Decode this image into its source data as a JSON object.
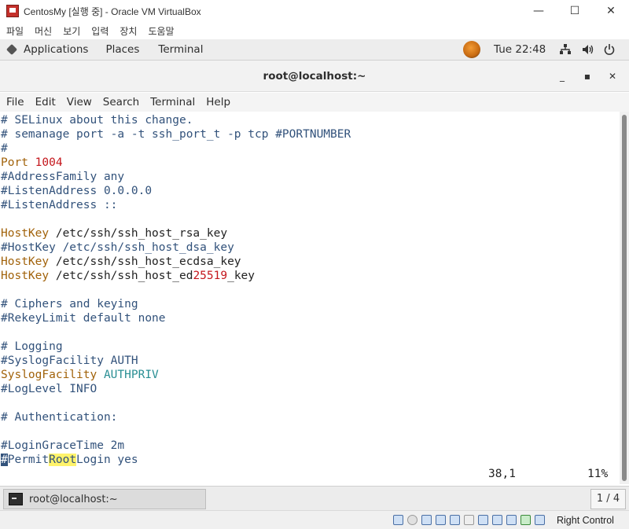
{
  "vbox": {
    "title": "CentosMy [실행 중] - Oracle VM VirtualBox",
    "minimize": "—",
    "maximize": "☐",
    "close": "✕",
    "menu": [
      "파일",
      "머신",
      "보기",
      "입력",
      "장치",
      "도움말"
    ],
    "host_key": "Right Control"
  },
  "gnome": {
    "applications": "Applications",
    "places": "Places",
    "terminal": "Terminal",
    "clock": "Tue 22:48",
    "network_icon": "network-icon",
    "volume_icon": "volume-icon",
    "power_icon": "power-icon"
  },
  "terminal": {
    "title": "root@localhost:~",
    "min": "_",
    "max": "▪",
    "close": "✕",
    "menu": [
      "File",
      "Edit",
      "View",
      "Search",
      "Terminal",
      "Help"
    ],
    "lines": [
      {
        "segments": [
          {
            "t": "# SELinux about this change.",
            "c": "c"
          }
        ]
      },
      {
        "segments": [
          {
            "t": "# semanage port -a -t ssh_port_t -p tcp #PORTNUMBER",
            "c": "c"
          }
        ]
      },
      {
        "segments": [
          {
            "t": "#",
            "c": "c"
          }
        ]
      },
      {
        "segments": [
          {
            "t": "Port ",
            "c": "kw"
          },
          {
            "t": "1004",
            "c": "num"
          }
        ]
      },
      {
        "segments": [
          {
            "t": "#AddressFamily any",
            "c": "c"
          }
        ]
      },
      {
        "segments": [
          {
            "t": "#ListenAddress 0.0.0.0",
            "c": "c"
          }
        ]
      },
      {
        "segments": [
          {
            "t": "#ListenAddress ::",
            "c": "c"
          }
        ]
      },
      {
        "segments": []
      },
      {
        "segments": [
          {
            "t": "HostKey",
            "c": "kw"
          },
          {
            "t": " /etc/ssh/ssh_host_rsa_key",
            "c": "tx"
          }
        ]
      },
      {
        "segments": [
          {
            "t": "#HostKey /etc/ssh/ssh_host_dsa_key",
            "c": "c"
          }
        ]
      },
      {
        "segments": [
          {
            "t": "HostKey",
            "c": "kw"
          },
          {
            "t": " /etc/ssh/ssh_host_ecdsa_key",
            "c": "tx"
          }
        ]
      },
      {
        "segments": [
          {
            "t": "HostKey",
            "c": "kw"
          },
          {
            "t": " /etc/ssh/ssh_host_ed",
            "c": "tx"
          },
          {
            "t": "25519",
            "c": "num"
          },
          {
            "t": "_key",
            "c": "tx"
          }
        ]
      },
      {
        "segments": []
      },
      {
        "segments": [
          {
            "t": "# Ciphers and keying",
            "c": "c"
          }
        ]
      },
      {
        "segments": [
          {
            "t": "#RekeyLimit default none",
            "c": "c"
          }
        ]
      },
      {
        "segments": []
      },
      {
        "segments": [
          {
            "t": "# Logging",
            "c": "c"
          }
        ]
      },
      {
        "segments": [
          {
            "t": "#SyslogFacility AUTH",
            "c": "c"
          }
        ]
      },
      {
        "segments": [
          {
            "t": "SyslogFacility",
            "c": "kw"
          },
          {
            "t": " AUTHPRIV",
            "c": "cy"
          }
        ]
      },
      {
        "segments": [
          {
            "t": "#LogLevel INFO",
            "c": "c"
          }
        ]
      },
      {
        "segments": []
      },
      {
        "segments": [
          {
            "t": "# Authentication:",
            "c": "c"
          }
        ]
      },
      {
        "segments": []
      },
      {
        "segments": [
          {
            "t": "#LoginGraceTime 2m",
            "c": "c"
          }
        ]
      },
      {
        "segments": [
          {
            "t": "#",
            "c": "cursor"
          },
          {
            "t": "Permit",
            "c": "c"
          },
          {
            "t": "Root",
            "c": "c hl"
          },
          {
            "t": "Login yes",
            "c": "c"
          }
        ]
      }
    ],
    "cursor_pos": "38,1",
    "percent": "11%"
  },
  "taskbar": {
    "window_label": "root@localhost:~",
    "workspace": "1 / 4"
  },
  "colors": {
    "comment": "#32527b",
    "keyword": "#a1620a",
    "number": "#c4161c",
    "highlight": "#fff36b",
    "cyan": "#2a8f94"
  }
}
